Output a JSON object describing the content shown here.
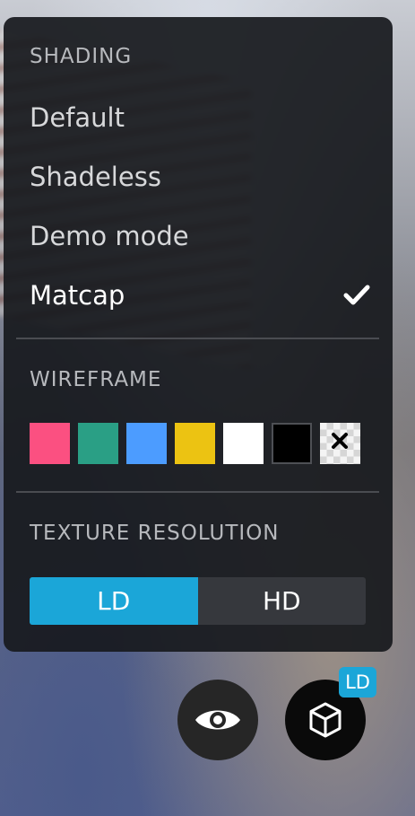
{
  "shading": {
    "title": "SHADING",
    "items": [
      {
        "label": "Default",
        "selected": false
      },
      {
        "label": "Shadeless",
        "selected": false
      },
      {
        "label": "Demo mode",
        "selected": false
      },
      {
        "label": "Matcap",
        "selected": true
      }
    ]
  },
  "wireframe": {
    "title": "WIREFRAME",
    "colors": [
      "#fb5081",
      "#2a9f85",
      "#4c9cff",
      "#ecc312",
      "#ffffff",
      "#000000",
      "none"
    ]
  },
  "texture": {
    "title": "TEXTURE RESOLUTION",
    "options": [
      {
        "label": "LD",
        "selected": true
      },
      {
        "label": "HD",
        "selected": false
      }
    ],
    "badge": "LD"
  },
  "accent_color": "#1ba6d8"
}
